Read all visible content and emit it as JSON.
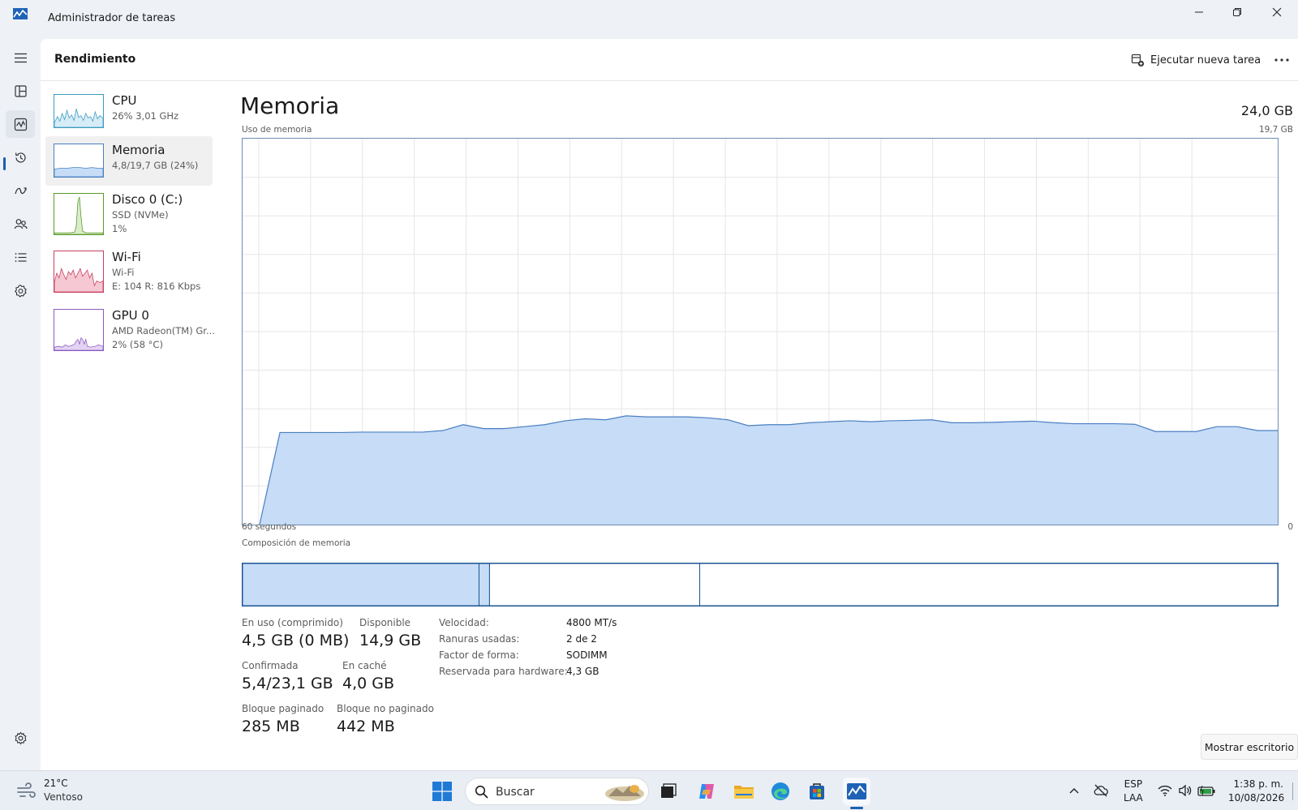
{
  "window": {
    "title": "Administrador de tareas"
  },
  "header": {
    "page_title": "Rendimiento",
    "run_task_label": "Ejecutar nueva tarea"
  },
  "nav": {
    "items": [
      "menu-icon",
      "processes-icon",
      "performance-icon",
      "app-history-icon",
      "startup-icon",
      "users-icon",
      "details-icon",
      "services-icon",
      "settings-icon"
    ],
    "active": "performance-icon"
  },
  "devices": [
    {
      "name": "CPU",
      "line1": "26% 3,01 GHz",
      "line2": ""
    },
    {
      "name": "Memoria",
      "line1": "4,8/19,7 GB (24%)",
      "line2": ""
    },
    {
      "name": "Disco 0 (C:)",
      "line1": "SSD (NVMe)",
      "line2": "1%"
    },
    {
      "name": "Wi-Fi",
      "line1": "Wi-Fi",
      "line2": "E: 104 R: 816 Kbps"
    },
    {
      "name": "GPU 0",
      "line1": "AMD Radeon(TM) Gr...",
      "line2": "2% (58 °C)"
    }
  ],
  "memory": {
    "title": "Memoria",
    "total": "24,0 GB",
    "usage_label": "Uso de memoria",
    "usage_max": "19,7 GB",
    "time_left": "60 segundos",
    "time_right": "0",
    "composition_label": "Composición de memoria",
    "composition": {
      "in_use": 4.5,
      "modified": 0.2,
      "standby": 4.0,
      "free": 11.0
    },
    "usage_series": [
      0,
      4.7,
      4.7,
      4.7,
      4.7,
      4.72,
      4.72,
      4.72,
      4.72,
      4.8,
      5.1,
      4.9,
      4.9,
      5.0,
      5.1,
      5.3,
      5.4,
      5.35,
      5.55,
      5.5,
      5.5,
      5.5,
      5.45,
      5.35,
      5.05,
      5.1,
      5.1,
      5.2,
      5.25,
      5.3,
      5.25,
      5.3,
      5.32,
      5.35,
      5.2,
      5.2,
      5.22,
      5.25,
      5.28,
      5.2,
      5.15,
      5.15,
      5.15,
      5.12,
      4.75,
      4.75,
      4.75,
      5.0,
      5.0,
      4.8,
      4.8
    ],
    "stats": {
      "in_use_label": "En uso (comprimido)",
      "in_use_value": "4,5 GB (0 MB)",
      "available_label": "Disponible",
      "available_value": "14,9 GB",
      "committed_label": "Confirmada",
      "committed_value": "5,4/23,1 GB",
      "cached_label": "En caché",
      "cached_value": "4,0 GB",
      "paged_label": "Bloque paginado",
      "paged_value": "285 MB",
      "nonpaged_label": "Bloque no paginado",
      "nonpaged_value": "442 MB"
    },
    "details": [
      {
        "label": "Velocidad:",
        "value": "4800 MT/s"
      },
      {
        "label": "Ranuras usadas:",
        "value": "2 de 2"
      },
      {
        "label": "Factor de forma:",
        "value": "SODIMM"
      },
      {
        "label": "Reservada para hardware:",
        "value": "4,3 GB"
      }
    ]
  },
  "show_desktop": "Mostrar escritorio",
  "taskbar": {
    "weather_temp": "21°C",
    "weather_desc": "Ventoso",
    "search_placeholder": "Buscar",
    "lang_top": "ESP",
    "lang_bottom": "LAA",
    "time": "1:38 p. m.",
    "date": "10/08/2026"
  },
  "colors": {
    "accent": "#1a5fb4",
    "memory_fill": "#c6dcf7",
    "memory_line": "#4a7fc1",
    "cpu": "#3d9bc3",
    "disk": "#5a9a2a",
    "wifi": "#c7405f",
    "gpu": "#8a5ac2"
  }
}
